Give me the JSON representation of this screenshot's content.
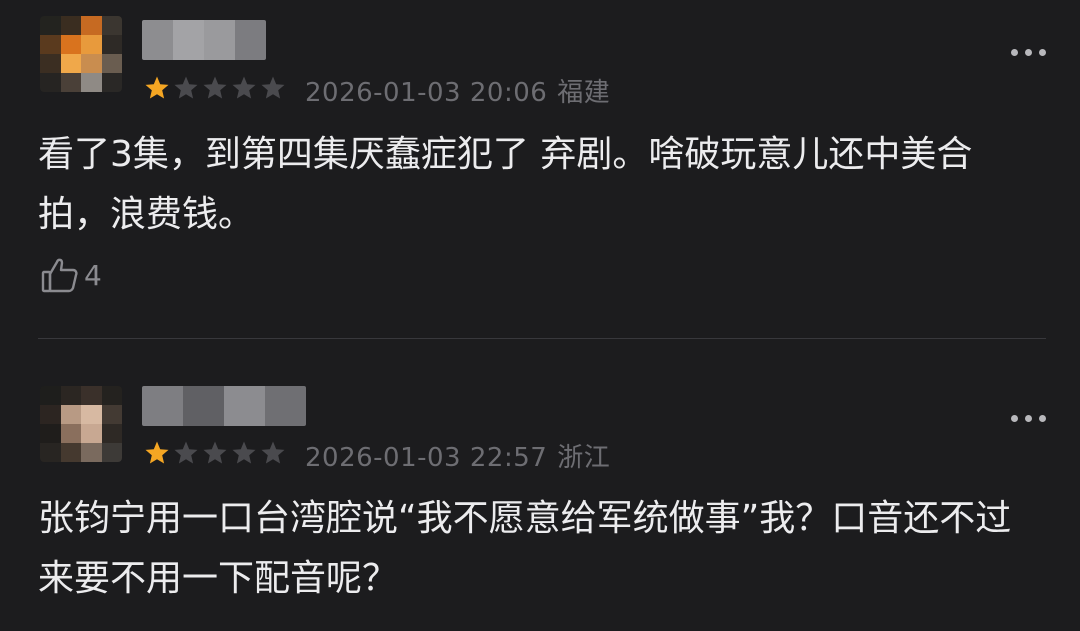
{
  "comments": [
    {
      "rating": 1,
      "max_rating": 5,
      "date": "2026-01-03 20:06",
      "location": "福建",
      "text": "看了3集，到第四集厌蠢症犯了 弃剧。啥破玩意儿还中美合拍，浪费钱。",
      "likes": "4"
    },
    {
      "rating": 1,
      "max_rating": 5,
      "date": "2026-01-03 22:57",
      "location": "浙江",
      "text": "张钧宁用一口台湾腔说“我不愿意给军统做事”我？口音还不过来要不用一下配音呢？"
    }
  ],
  "colors": {
    "background": "#1c1c1e",
    "star_filled": "#f5a623",
    "star_empty": "#4a4a4e",
    "meta_text": "#6d6d72",
    "body_text": "#ececee"
  },
  "icons": {
    "star": "star-icon",
    "more": "more-dots-icon",
    "like": "thumbs-up-icon"
  }
}
